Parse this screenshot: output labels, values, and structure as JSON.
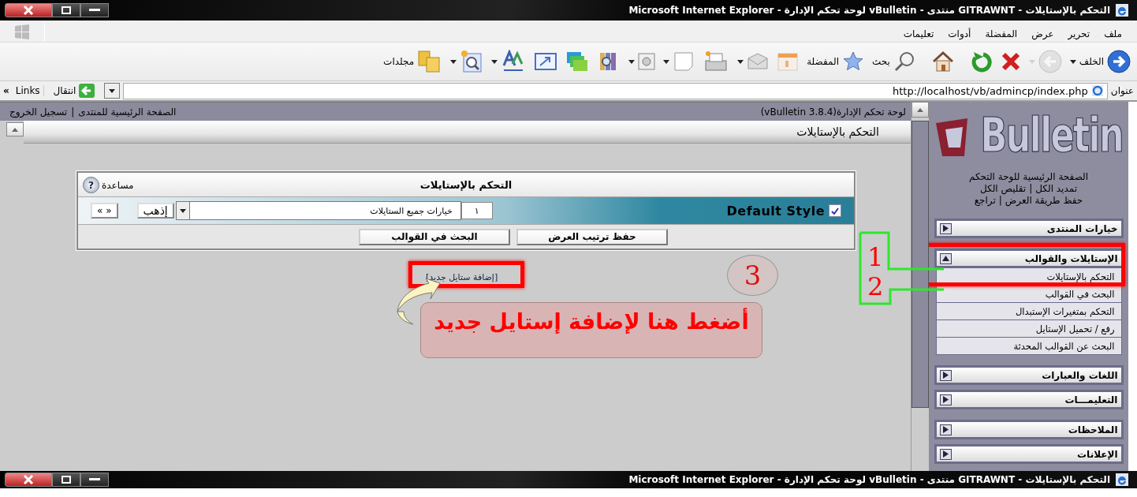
{
  "window": {
    "title": "التحكم بالإستايلات - GITRAWNT منتدى - vBulletin لوحة تحكم الإدارة - Microsoft Internet Explorer"
  },
  "menu": [
    "ملف",
    "تحرير",
    "عرض",
    "المفضلة",
    "أدوات",
    "تعليمات"
  ],
  "toolbar": [
    {
      "kind": "back",
      "label": "الخلف",
      "dropdown": true,
      "disabled": false
    },
    {
      "kind": "forward",
      "dropdown": true,
      "disabled": true
    },
    {
      "kind": "stop",
      "dropdown": false,
      "disabled": false
    },
    {
      "kind": "refresh",
      "dropdown": false,
      "disabled": false
    },
    {
      "kind": "home",
      "dropdown": false,
      "disabled": false
    },
    {
      "kind": "search",
      "label": "بحث",
      "dropdown": false,
      "disabled": false
    },
    {
      "kind": "favorites",
      "label": "المفضلة",
      "dropdown": false,
      "disabled": false
    },
    {
      "kind": "history",
      "dropdown": false,
      "disabled": false
    },
    {
      "kind": "mail",
      "dropdown": true,
      "disabled": false
    },
    {
      "kind": "print",
      "dropdown": false,
      "disabled": false
    },
    {
      "kind": "page",
      "dropdown": true,
      "disabled": false
    },
    {
      "kind": "box",
      "dropdown": true,
      "disabled": false
    },
    {
      "kind": "research",
      "dropdown": false,
      "disabled": false
    },
    {
      "kind": "windows",
      "dropdown": false,
      "disabled": false
    },
    {
      "kind": "resize",
      "dropdown": false,
      "disabled": false
    },
    {
      "kind": "fonts",
      "dropdown": true,
      "disabled": false
    },
    {
      "kind": "zoom",
      "dropdown": true,
      "disabled": false
    },
    {
      "kind": "folders",
      "label": "مجلدات",
      "dropdown": false,
      "disabled": false
    }
  ],
  "address_bar": {
    "label": "عنوان",
    "value": "http://localhost/vb/admincp/index.php",
    "go": "انتقال",
    "links": "Links",
    "more": "»"
  },
  "top_bar": {
    "title": "لوحة تحكم الإدارة(vBulletin 3.8.4)",
    "links": [
      "الصفحة الرئيسية للمنتدى",
      "تسجيل الخروج"
    ],
    "separator": "|"
  },
  "page_header": "التحكم بالإستايلات",
  "panel": {
    "title": "التحكم بالإستايلات",
    "help": "مساعدة",
    "help_icon": "?",
    "style": {
      "name": "Default Style",
      "checked": true,
      "order": "١",
      "options": "خيارات جميع الستايلات",
      "go": "إذهب",
      "pager": "« »"
    },
    "buttons": [
      "حفظ ترتيب العرض",
      "البحث في القوالب"
    ]
  },
  "add_link": "[إضافة ستايل جديد]",
  "annotations": {
    "step": "3",
    "callout": "أضغط هنا لإضافة إستايل جديد",
    "markers": [
      "1",
      "2"
    ]
  },
  "sidebar": {
    "logo": "Bulletin",
    "links": [
      {
        "items": [
          "الصفحة الرئيسية للوحة التحكم"
        ]
      },
      {
        "items": [
          "تمديد الكل",
          "تقليص الكل"
        ],
        "separator": "|"
      },
      {
        "items": [
          "حفظ طريقة العرض",
          "تراجع"
        ],
        "separator": "|"
      }
    ],
    "groups": [
      {
        "title": "خيارات المنتدى",
        "expanded": false
      },
      {
        "title": "الإستايلات والقوالب",
        "expanded": true,
        "children": [
          "التحكم بالإستايلات",
          "البحث في القوالب",
          "التحكم بمتغيرات الإستبدال",
          "رفع / تحميل الإستايل",
          "البحث عن القوالب المحدثة"
        ]
      },
      {
        "title": "اللغات والعبارات",
        "expanded": false
      },
      {
        "title": "التعليمـــات",
        "expanded": false
      },
      {
        "title": "الملاحظات",
        "expanded": false
      },
      {
        "title": "الإعلانات",
        "expanded": false
      }
    ]
  },
  "bottom_bar": {
    "title": "التحكم بالإستايلات - GITRAWNT منتدى - vBulletin لوحة تحكم الإدارة - Microsoft Internet Explorer"
  }
}
